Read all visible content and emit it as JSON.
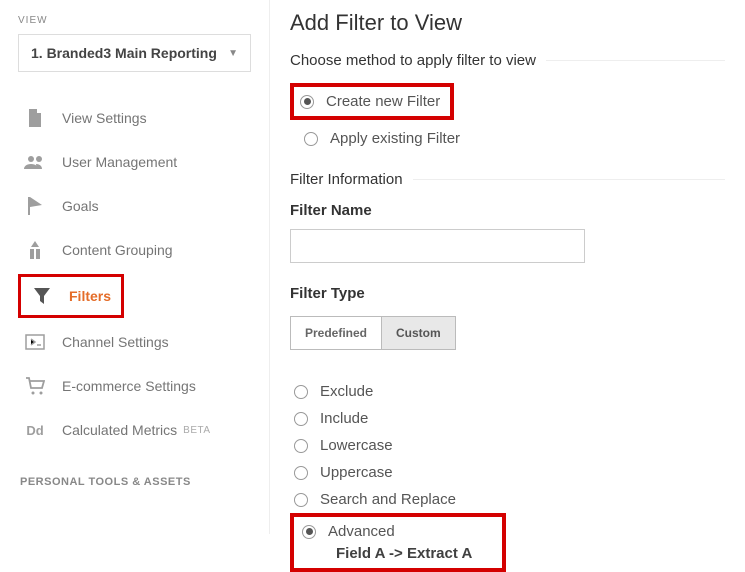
{
  "sidebar": {
    "viewLabel": "VIEW",
    "viewName": "1. Branded3 Main Reporting",
    "nav": {
      "viewSettings": "View Settings",
      "userManagement": "User Management",
      "goals": "Goals",
      "contentGrouping": "Content Grouping",
      "filters": "Filters",
      "channelSettings": "Channel Settings",
      "ecommerceSettings": "E-commerce Settings",
      "calculatedMetrics": "Calculated Metrics",
      "betaTag": "BETA"
    },
    "sectionHeader": "PERSONAL TOOLS & ASSETS"
  },
  "main": {
    "title": "Add Filter to View",
    "methodLabel": "Choose method to apply filter to view",
    "methods": {
      "create": "Create new Filter",
      "apply": "Apply existing Filter"
    },
    "filterInfoLabel": "Filter Information",
    "filterNameLabel": "Filter Name",
    "filterNameValue": "",
    "filterTypeLabel": "Filter Type",
    "tabs": {
      "predefined": "Predefined",
      "custom": "Custom"
    },
    "options": {
      "exclude": "Exclude",
      "include": "Include",
      "lowercase": "Lowercase",
      "uppercase": "Uppercase",
      "searchReplace": "Search and Replace",
      "advanced": "Advanced",
      "fieldExtract": "Field A -> Extract A"
    }
  }
}
